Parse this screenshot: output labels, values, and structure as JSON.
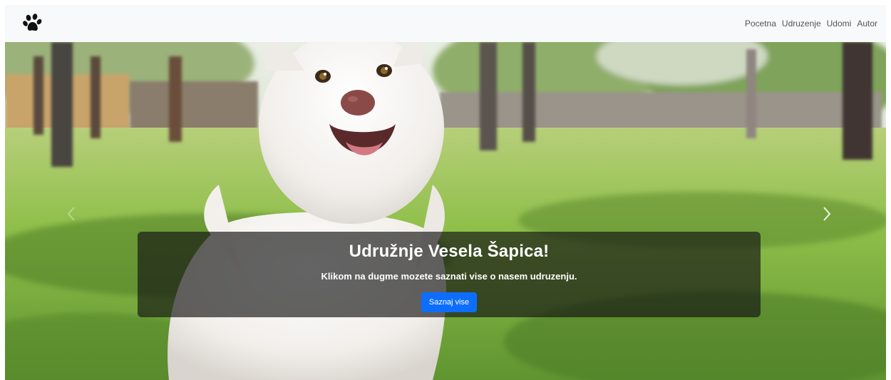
{
  "navbar": {
    "logo_icon": "paw-icon",
    "links": [
      "Pocetna",
      "Udruzenje",
      "Udomi",
      "Autor"
    ]
  },
  "hero": {
    "image": "white-puppy-in-park-photo",
    "prev_icon": "chevron-left-icon",
    "next_icon": "chevron-right-icon",
    "caption": {
      "title": "Udružnje Vesela Šapica!",
      "text": "Klikom na dugme mozete saznati vise o nasem udruzenju.",
      "button_label": "Saznaj vise"
    }
  },
  "colors": {
    "navbar_bg": "#f8f9fa",
    "button": "#0d6efd",
    "caption_bg": "rgba(20,20,20,0.66)"
  }
}
